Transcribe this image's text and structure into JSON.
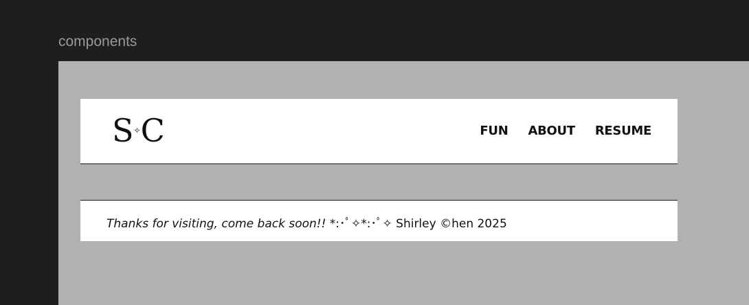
{
  "frame": {
    "label": "components"
  },
  "navbar": {
    "logo": {
      "left": "S",
      "sparkle": "✧",
      "right": "C"
    },
    "links": [
      "FUN",
      "ABOUT",
      "RESUME"
    ]
  },
  "footer": {
    "message": "Thanks for visiting, come back soon!!",
    "signature": " *:･ﾟ✧*:･ﾟ✧ Shirley ©hen 2025"
  },
  "colors": {
    "background": "#1e1e1e",
    "canvas": "#b1b1b1",
    "surface": "#ffffff",
    "text": "#111111",
    "frame_label": "#9a9a9a"
  }
}
